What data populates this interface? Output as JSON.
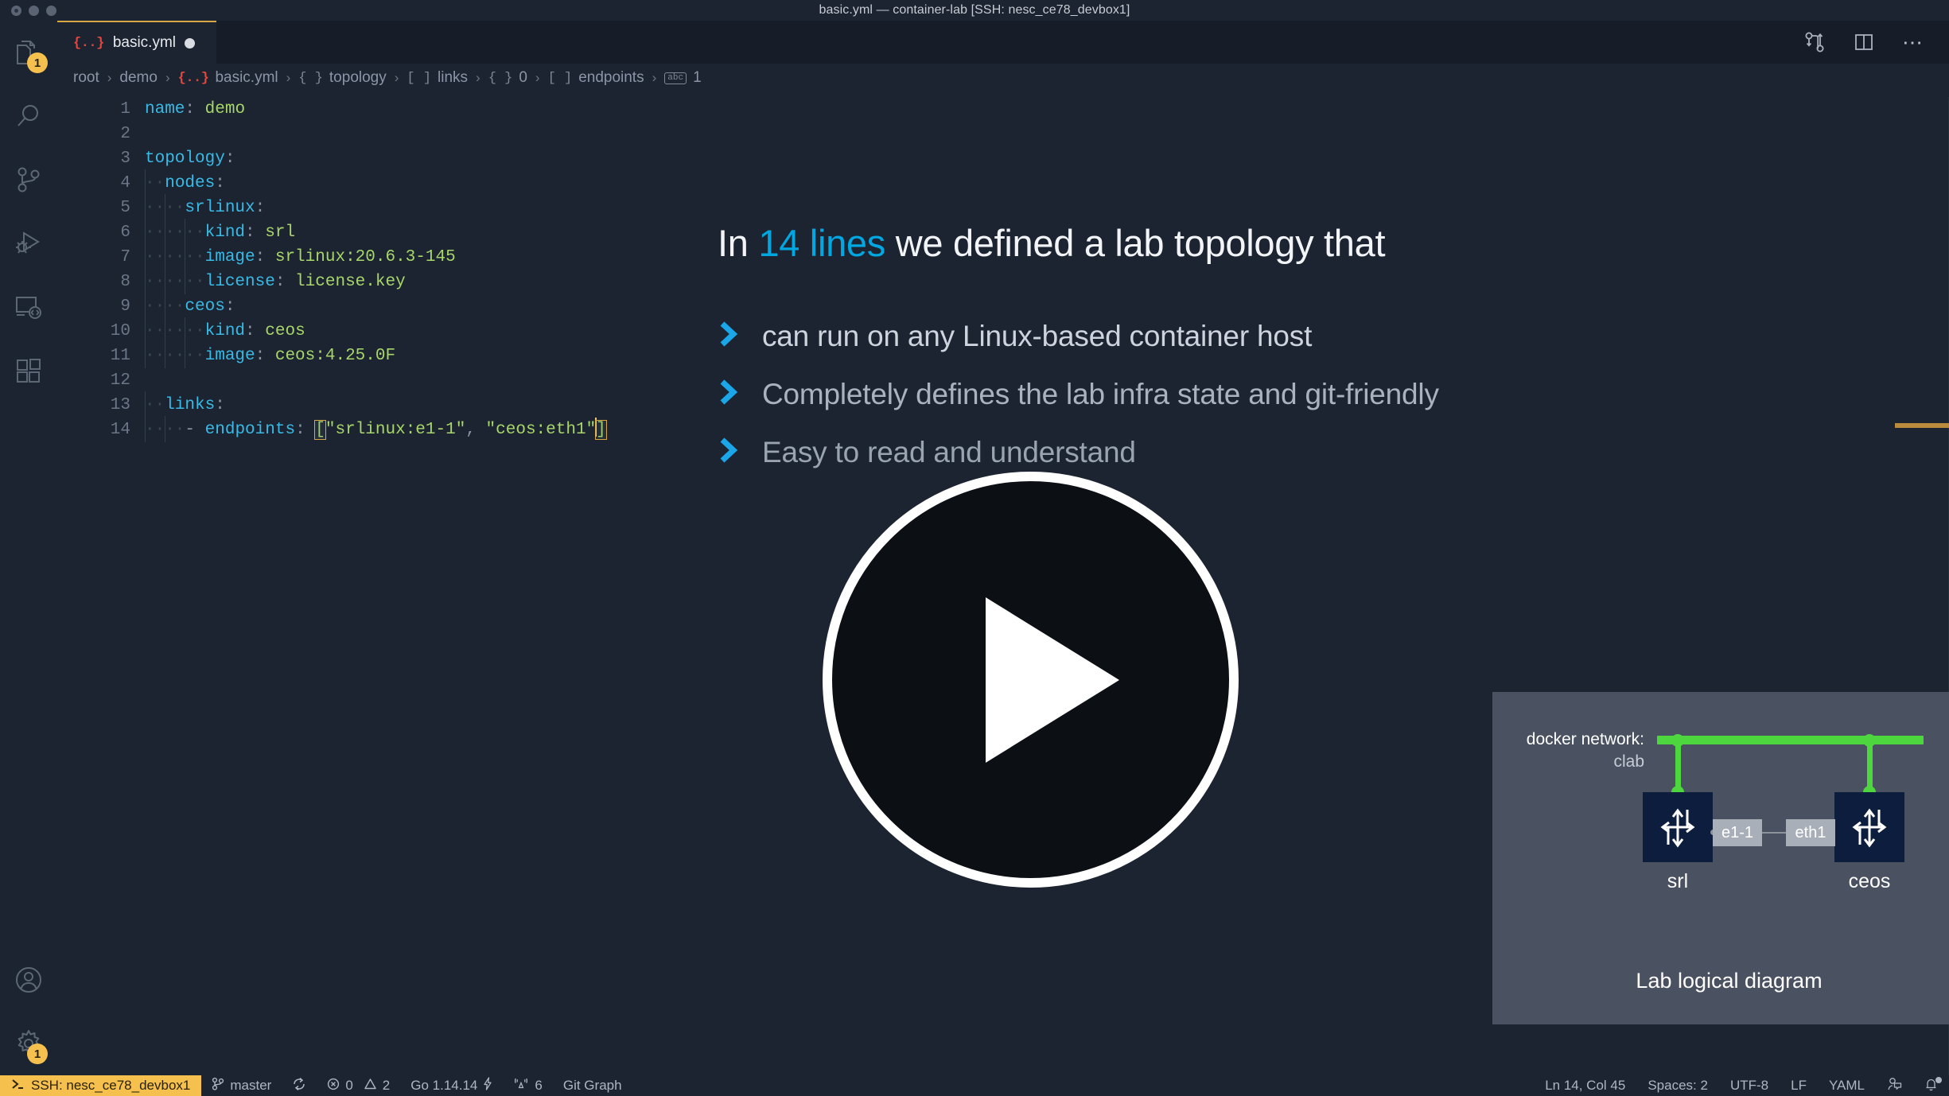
{
  "window": {
    "title": "basic.yml — container-lab [SSH: nesc_ce78_devbox1]"
  },
  "activity_bar": {
    "items": [
      {
        "name": "explorer",
        "icon": "files-icon",
        "badge": "1"
      },
      {
        "name": "search",
        "icon": "search-icon",
        "badge": ""
      },
      {
        "name": "source-control",
        "icon": "source-control-icon",
        "badge": ""
      },
      {
        "name": "run-debug",
        "icon": "run-debug-icon",
        "badge": ""
      },
      {
        "name": "remote-explorer",
        "icon": "remote-explorer-icon",
        "badge": ""
      },
      {
        "name": "extensions",
        "icon": "extensions-icon",
        "badge": ""
      }
    ],
    "bottom_items": [
      {
        "name": "accounts",
        "icon": "account-icon",
        "badge": ""
      },
      {
        "name": "manage",
        "icon": "gear-icon",
        "badge": "1"
      }
    ]
  },
  "tab": {
    "icon": "yaml-braces-icon",
    "icon_glyph": "{..}",
    "label": "basic.yml",
    "dirty": true
  },
  "tab_actions": [
    {
      "name": "compare-changes-icon"
    },
    {
      "name": "split-editor-icon"
    },
    {
      "name": "more-actions-icon",
      "glyph": "⋯"
    }
  ],
  "breadcrumb": {
    "segments": [
      {
        "icon": "",
        "glyph": "",
        "label": "root"
      },
      {
        "icon": "",
        "glyph": "",
        "label": "demo"
      },
      {
        "icon": "yaml-braces-icon",
        "glyph": "{..}",
        "label": "basic.yml"
      },
      {
        "icon": "object-icon",
        "glyph": "{ }",
        "label": "topology"
      },
      {
        "icon": "array-icon",
        "glyph": "[ ]",
        "label": "links"
      },
      {
        "icon": "object-icon",
        "glyph": "{ }",
        "label": "0"
      },
      {
        "icon": "array-icon",
        "glyph": "[ ]",
        "label": "endpoints"
      },
      {
        "icon": "string-icon",
        "glyph": "abc",
        "label": "1"
      }
    ],
    "separator": "›"
  },
  "editor": {
    "language": "YAML",
    "lines": [
      {
        "n": "1",
        "indent": "",
        "text": "name: demo",
        "key": "name",
        "value": " demo"
      },
      {
        "n": "2",
        "indent": "",
        "text": ""
      },
      {
        "n": "3",
        "indent": "",
        "text": "topology:",
        "key": "topology",
        "value": ""
      },
      {
        "n": "4",
        "indent": "··",
        "text": "nodes:",
        "key": "nodes",
        "value": ""
      },
      {
        "n": "5",
        "indent": "····",
        "text": "srlinux:",
        "key": "srlinux",
        "value": ""
      },
      {
        "n": "6",
        "indent": "······",
        "text": "kind: srl",
        "key": "kind",
        "value": " srl"
      },
      {
        "n": "7",
        "indent": "······",
        "text": "image: srlinux:20.6.3-145",
        "key": "image",
        "value": " srlinux:20.6.3-145"
      },
      {
        "n": "8",
        "indent": "······",
        "text": "license: license.key",
        "key": "license",
        "value": " license.key"
      },
      {
        "n": "9",
        "indent": "····",
        "text": "ceos:",
        "key": "ceos",
        "value": ""
      },
      {
        "n": "10",
        "indent": "······",
        "text": "kind: ceos",
        "key": "kind",
        "value": " ceos"
      },
      {
        "n": "11",
        "indent": "······",
        "text": "image: ceos:4.25.0F",
        "key": "image",
        "value": " ceos:4.25.0F"
      },
      {
        "n": "12",
        "indent": "",
        "text": ""
      },
      {
        "n": "13",
        "indent": "··",
        "text": "links:",
        "key": "links",
        "value": ""
      },
      {
        "n": "14",
        "indent": "····",
        "text": "- endpoints: [\"srlinux:e1-1\", \"ceos:eth1\"]",
        "key": "endpoints",
        "value": "[\"srlinux:e1-1\", \"ceos:eth1\"]"
      }
    ],
    "line14": {
      "dash": "- ",
      "key": "endpoints",
      "colon": ": ",
      "open_bracket": "[",
      "str1": "\"srlinux:e1-1\"",
      "comma": ", ",
      "str2": "\"ceos:eth1\"",
      "close_bracket": "]"
    }
  },
  "overlay": {
    "headline_pre": "In ",
    "headline_highlight": "14 lines",
    "headline_post": " we defined a lab topology that",
    "bullets": [
      "can run on any Linux-based container host",
      "Completely defines the lab infra state and git-friendly",
      "Easy to read and understand"
    ],
    "play_button": "play-button"
  },
  "diagram": {
    "network_label_line1": "docker network:",
    "network_label_line2": "clab",
    "node_left": "srl",
    "node_right": "ceos",
    "iface_left": "e1-1",
    "iface_right": "eth1",
    "caption": "Lab logical diagram"
  },
  "status_bar": {
    "remote": {
      "icon": "remote-ssh-icon",
      "label": "SSH: nesc_ce78_devbox1"
    },
    "left_items": [
      {
        "name": "branch",
        "icon": "source-control-icon",
        "label": "master"
      },
      {
        "name": "sync",
        "icon": "sync-icon",
        "label": ""
      },
      {
        "name": "problems",
        "icon": "error-warning-icon",
        "label": "0",
        "label2": "2"
      },
      {
        "name": "go-version",
        "icon": "",
        "label": "Go 1.14.14",
        "suffix_icon": "zap-icon"
      },
      {
        "name": "broadcast",
        "icon": "broadcast-icon",
        "label": "6"
      },
      {
        "name": "git-graph",
        "icon": "",
        "label": "Git Graph"
      }
    ],
    "right_items": [
      {
        "name": "cursor-position",
        "label": "Ln 14, Col 45"
      },
      {
        "name": "indentation",
        "label": "Spaces: 2"
      },
      {
        "name": "encoding",
        "label": "UTF-8"
      },
      {
        "name": "eol",
        "label": "LF"
      },
      {
        "name": "language-mode",
        "label": "YAML"
      },
      {
        "name": "feedback",
        "icon": "feedback-icon",
        "label": ""
      },
      {
        "name": "notifications",
        "icon": "bell-icon",
        "label": ""
      }
    ]
  },
  "colors": {
    "background": "#1b2430",
    "accent_yellow": "#f5c04e",
    "accent_cyan": "#00a7e1",
    "yaml_key": "#39bae6",
    "yaml_string": "#a8d66a",
    "network_green": "#4ed63f",
    "node_navy": "#0c1d3d",
    "panel_gray": "#4a5161"
  }
}
